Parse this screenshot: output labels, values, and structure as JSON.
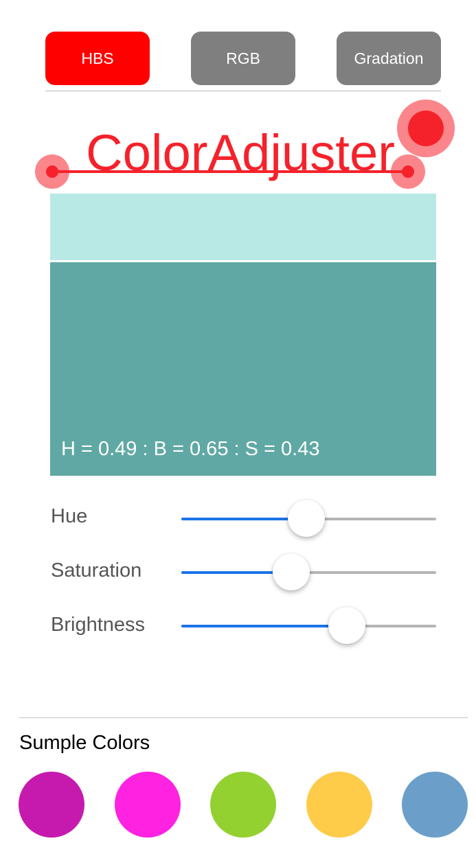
{
  "tabs": [
    {
      "label": "HBS",
      "color": "#ff0000",
      "active": true
    },
    {
      "label": "RGB",
      "color": "#7f7f7f",
      "active": false
    },
    {
      "label": "Gradation",
      "color": "#7f7f7f",
      "active": false
    }
  ],
  "logo": {
    "text": "ColorAdjuster",
    "color": "#f5222b"
  },
  "preview": {
    "light_color": "#b8e9e5",
    "main_color": "#60a8a3",
    "readout": "H = 0.49 : B = 0.65 : S = 0.43"
  },
  "sliders": [
    {
      "label": "Hue",
      "value": 0.49
    },
    {
      "label": "Saturation",
      "value": 0.43
    },
    {
      "label": "Brightness",
      "value": 0.65
    }
  ],
  "slider_colors": {
    "fill": "#1a73e8",
    "track": "#b5b5b5"
  },
  "samples": {
    "title": "Sumple Colors",
    "colors": [
      "#c61aaf",
      "#ff22e1",
      "#93d131",
      "#ffcc4a",
      "#6b9fca"
    ]
  }
}
